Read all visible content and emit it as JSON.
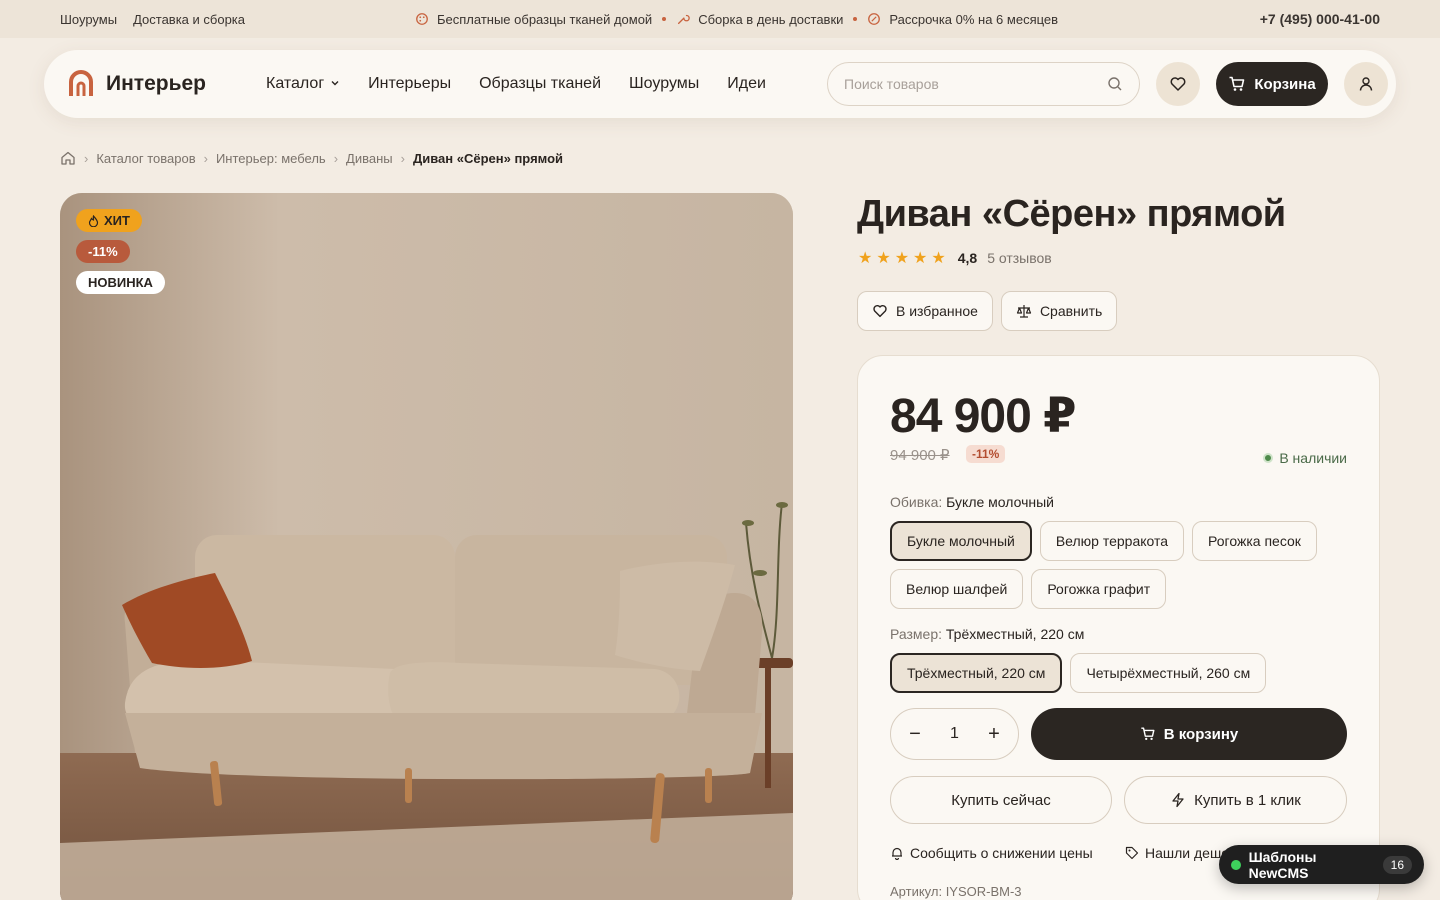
{
  "topbar": {
    "links": [
      "Шоурумы",
      "Доставка и сборка"
    ],
    "promos": [
      "Бесплатные образцы тканей домой",
      "Сборка в день доставки",
      "Рассрочка 0% на 6 месяцев"
    ],
    "phone": "+7 (495) 000-41-00"
  },
  "header": {
    "logo_text": "Интерьер",
    "nav": [
      "Каталог",
      "Интерьеры",
      "Образцы тканей",
      "Шоурумы",
      "Идеи"
    ],
    "search_placeholder": "Поиск товаров",
    "cart_label": "Корзина"
  },
  "breadcrumb": [
    "Каталог товаров",
    "Интерьер: мебель",
    "Диваны",
    "Диван «Сёрен» прямой"
  ],
  "gallery": {
    "badges": {
      "hit": "ХИТ",
      "sale": "-11%",
      "new": "НОВИНКА"
    }
  },
  "product": {
    "title": "Диван «Сёрен» прямой",
    "rating": "4,8",
    "rating_value": 4.8,
    "reviews": "5 отзывов",
    "favorite_label": "В избранное",
    "compare_label": "Сравнить",
    "price": "84 900 ₽",
    "old_price": "94 900 ₽",
    "discount": "-11%",
    "stock": "В наличии",
    "upholstery_label": "Обивка:",
    "upholstery_selected": "Букле молочный",
    "upholstery_options": [
      "Букле молочный",
      "Велюр терракота",
      "Рогожка песок",
      "Велюр шалфей",
      "Рогожка графит"
    ],
    "size_label": "Размер:",
    "size_selected": "Трёхместный, 220 см",
    "size_options": [
      "Трёхместный, 220 см",
      "Четырёхместный, 260 см"
    ],
    "quantity": "1",
    "add_to_cart": "В корзину",
    "buy_now": "Купить сейчас",
    "one_click": "Купить в 1 клик",
    "notify": "Сообщить о снижении цены",
    "cheaper": "Нашли дешевле?",
    "sku": "Артикул: IYSOR-BM-3"
  },
  "widget": {
    "label": "Шаблоны NewCMS",
    "count": "16"
  },
  "colors": {
    "accent": "#c8633f",
    "dark": "#2b2622",
    "background": "#f3ece3",
    "badge_hit": "#f0a21d",
    "badge_sale": "#b85a3c",
    "in_stock": "#4e8a4a"
  }
}
